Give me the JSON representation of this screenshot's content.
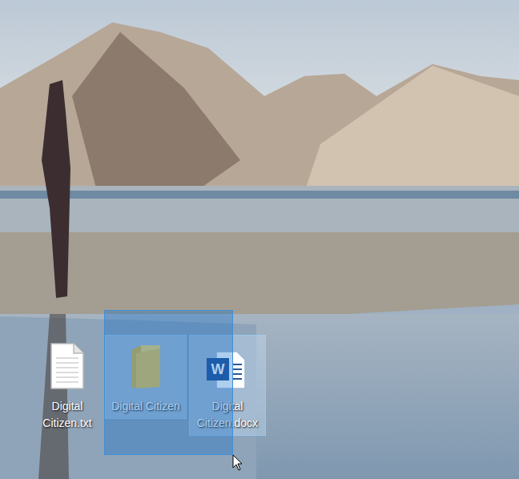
{
  "desktop": {
    "icons": [
      {
        "name": "Digital Citizen.txt",
        "kind": "text",
        "selected": false,
        "glyph": ""
      },
      {
        "name": "Digital Citizen",
        "kind": "folder",
        "selected": true,
        "glyph": ""
      },
      {
        "name": "Digital Citizen.docx",
        "kind": "word",
        "selected": true,
        "glyph": "W"
      }
    ],
    "selection_box": {
      "active": true
    }
  }
}
